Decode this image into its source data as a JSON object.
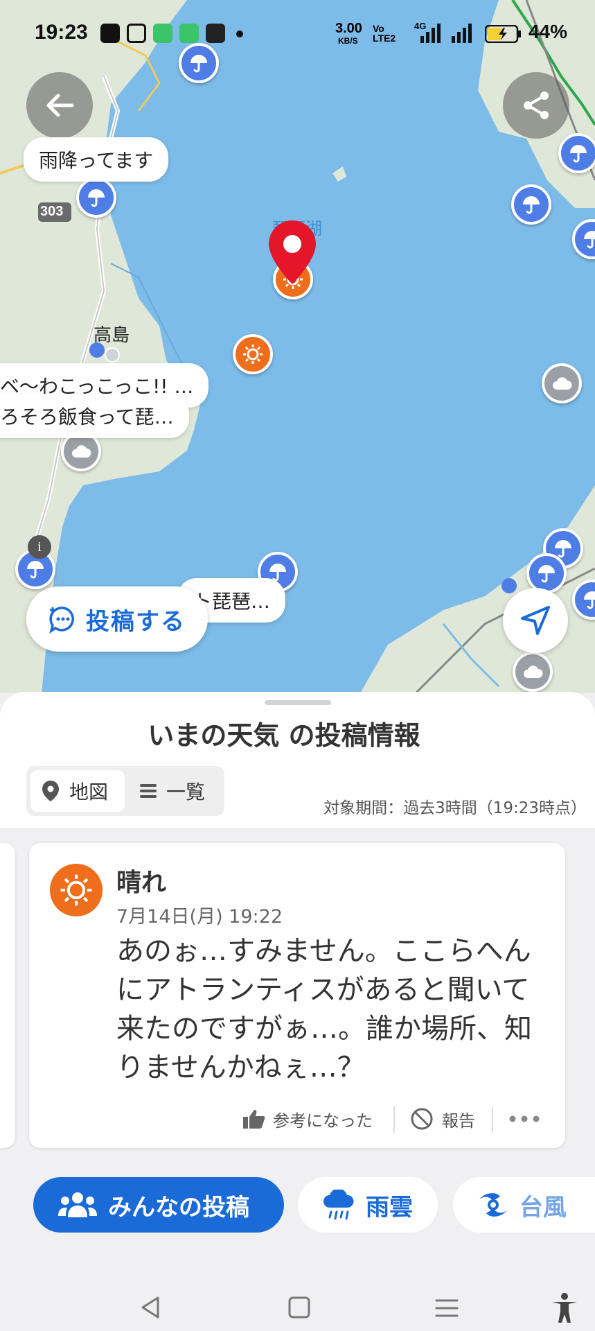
{
  "status_bar": {
    "time": "19:23",
    "battery": "44%",
    "net_speed": "3.00",
    "net_unit": "KB/S",
    "volte": "Vo LTE2",
    "net_type": "4G"
  },
  "map": {
    "lake_label": "琵琶湖",
    "place_label": "高島",
    "route_number": "303",
    "bubbles": [
      "雨降ってます",
      "ベ〜わこっこっこ!! …",
      "ろそろ飯食って琵…",
      "ト琵琶…"
    ],
    "post_button_label": "投稿する",
    "back_icon": "arrow-left-icon",
    "share_icon": "share-icon",
    "location_icon": "navigation-arrow-icon"
  },
  "sheet": {
    "title": "いまの天気 の投稿情報",
    "view_toggle": {
      "map_label": "地図",
      "list_label": "一覧",
      "selected": "地図"
    },
    "period": "対象期間：過去3時間（19:23時点）",
    "post": {
      "weather": "晴れ",
      "date": "7月14日(月) 19:22",
      "body": "あのぉ…すみません。ここらへんにアトランティスがあると聞いて来たのですがぁ…。誰か場所、知りませんかねぇ…？",
      "helpful_label": "参考になった",
      "report_label": "報告"
    },
    "tabs": [
      {
        "label": "みんなの投稿",
        "icon": "people-icon",
        "active": true
      },
      {
        "label": "雨雲",
        "icon": "rain-cloud-icon",
        "active": false
      },
      {
        "label": "台風",
        "icon": "typhoon-icon",
        "active": false
      }
    ]
  },
  "colors": {
    "accent": "#1a6ad8",
    "lake": "#7dbbe9",
    "land": "#dfe8d8",
    "sun": "#ee6e1c",
    "rain_pin": "#4e7de6",
    "selected_pin": "#e5162a"
  }
}
